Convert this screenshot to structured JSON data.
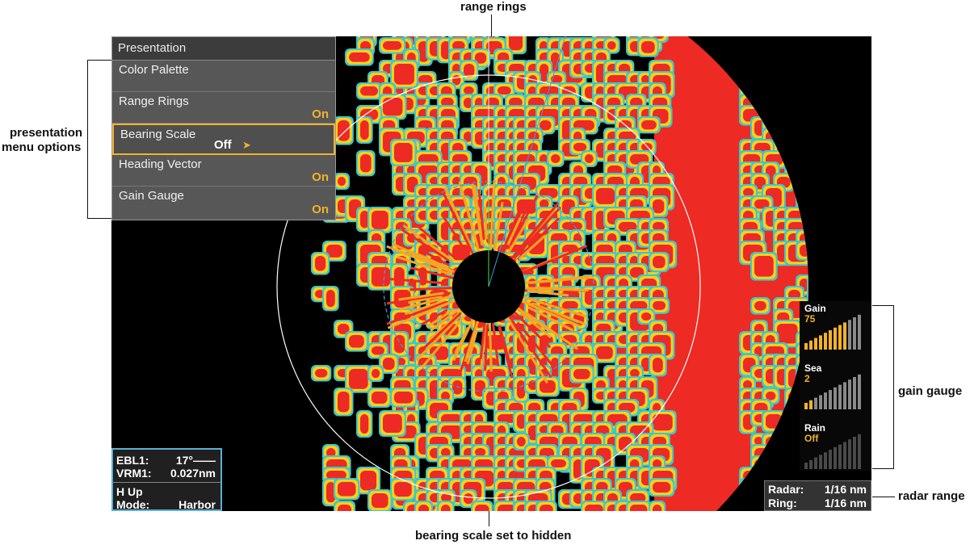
{
  "callouts": {
    "range_rings": "range rings",
    "presentation_menu_line1": "presentation",
    "presentation_menu_line2": "menu options",
    "gain_gauge": "gain gauge",
    "radar_range": "radar range",
    "bearing_scale": "bearing scale set to hidden"
  },
  "menu": {
    "title": "Presentation",
    "items": [
      {
        "label": "Color Palette",
        "value": ""
      },
      {
        "label": "Range Rings",
        "value": "On"
      },
      {
        "label": "Bearing Scale",
        "value": "Off",
        "selected": true
      },
      {
        "label": "Heading Vector",
        "value": "On"
      },
      {
        "label": "Gain Gauge",
        "value": "On"
      }
    ]
  },
  "info": {
    "ebl_label": "EBL1:",
    "ebl_value": "17°——",
    "vrm_label": "VRM1:",
    "vrm_value": "0.027nm",
    "orientation": "H Up",
    "mode_label": "Mode:",
    "mode_value": "Harbor"
  },
  "range": {
    "radar_label": "Radar:",
    "radar_value": "1/16 nm",
    "ring_label": "Ring:",
    "ring_value": "1/16 nm"
  },
  "gauges": [
    {
      "name": "Gain",
      "value": "75",
      "level": 0.75,
      "active": true
    },
    {
      "name": "Sea",
      "value": "2",
      "level": 0.2,
      "active": true
    },
    {
      "name": "Rain",
      "value": "Off",
      "level": 0,
      "active": false
    }
  ],
  "colors": {
    "accent": "#f2b32a",
    "echo_red": "#ee2a24",
    "echo_yellow": "#f2d21e",
    "echo_cyan": "#3fc6c9",
    "ring_inner": "#4a9ad8",
    "ring_outer": "#ffffff"
  }
}
